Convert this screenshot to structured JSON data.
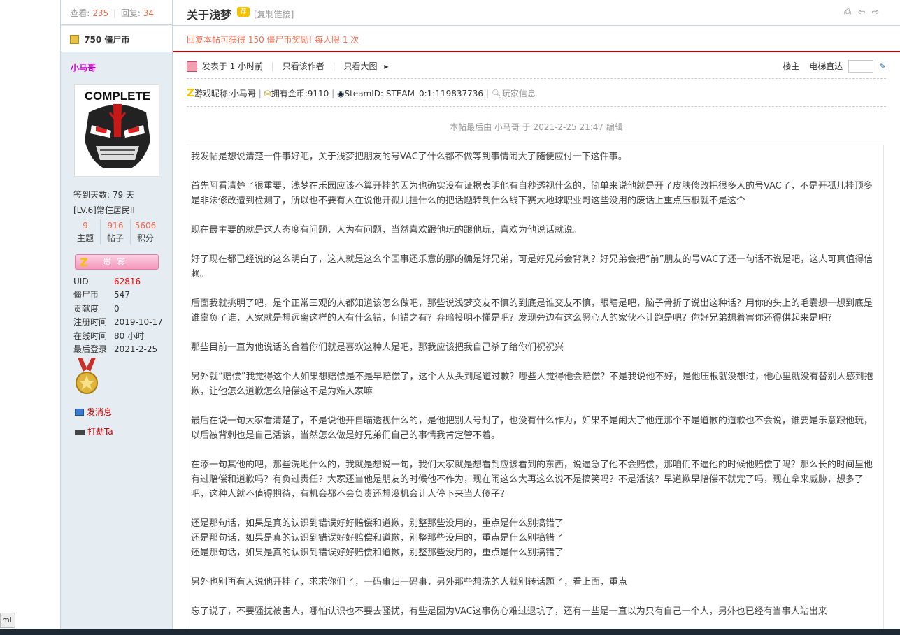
{
  "sidebar": {
    "views_label": "查看:",
    "views": "235",
    "replies_label": "回复:",
    "replies": "34",
    "coins_amount": "750",
    "coins_unit": "僵尸币",
    "username": "小马哥",
    "avatar_text": "COMPLETE",
    "checkin": "签到天数: 79 天",
    "level": "[LV.6]常住居民II",
    "stats": [
      {
        "value": "9",
        "label": "主题"
      },
      {
        "value": "916",
        "label": "帖子"
      },
      {
        "value": "5606",
        "label": "积分"
      }
    ],
    "vip_label": "贵宾",
    "vip_logo": "Z",
    "info": [
      {
        "key": "UID",
        "value": "62816"
      },
      {
        "key": "僵尸币",
        "value": "547"
      },
      {
        "key": "贡献度",
        "value": "0"
      },
      {
        "key": "注册时间",
        "value": "2019-10-17"
      },
      {
        "key": "在线时间",
        "value": "80 小时"
      },
      {
        "key": "最后登录",
        "value": "2021-2-25"
      }
    ],
    "send_message": "发消息",
    "rob": "打劫Ta"
  },
  "header": {
    "title": "关于浅梦",
    "badge": "荐",
    "copy_link": "[复制链接]",
    "reward_text": "回复本帖可获得 150 僵尸币奖励! 每人限 1 次"
  },
  "postbar": {
    "posted": "发表于 1 小时前",
    "only_author": "只看该作者",
    "large_image": "只看大图",
    "floor": "楼主",
    "elevator": "电梯直达"
  },
  "gameinfo": {
    "nickname": "游戏昵称:小马哥",
    "gold": "拥有金币:9110",
    "steam": "SteamID: STEAM_0:1:119837736",
    "player_info": "玩家信息"
  },
  "edited_note": "本帖最后由 小马哥 于 2021-2-25 21:47 编辑",
  "paragraphs": [
    "我发帖是想说清楚一件事好吧，关于浅梦把朋友的号VAC了什么都不做等到事情闹大了随便应付一下这件事。",
    "首先阿看清楚了很重要，浅梦在乐园应该不算开挂的因为也确实没有证据表明他有自秒透视什么的，简单来说他就是开了皮肤修改把很多人的号VAC了，不是开孤儿挂顶多是非法修改遭到检测了，所以也不要有人在说他开孤儿挂什么的把话题转到什么线下赛大地球职业哥这些没用的废话上重点压根就不是这个",
    "现在最主要的就是这人态度有问题，人为有问题，当然喜欢跟他玩的跟他玩，喜欢为他说话就说。",
    "好了现在都已经说的这么明白了，这人就是这么个回事还乐意的那的确是好兄弟，可是好兄弟会背刺？好兄弟会把“前”朋友的号VAC了还一句话不说是吧，这人可真值得信赖。",
    "后面我就挑明了吧，是个正常三观的人都知道该怎么做吧，那些说浅梦交友不慎的到底是谁交友不慎，眼瞎是吧，脑子骨折了说出这种话？用你的头上的毛囊想一想到底是谁辜负了谁，人家就是想远离这样的人有什么错，何错之有？弃暗投明不懂是吧？发现旁边有这么恶心人的家伙不让跑是吧？你好兄弟想着害你还得供起来是吧？",
    "那些目前一直为他说话的合着你们就是喜欢这种人是吧，那我应该把我自己杀了给你们祝祝兴",
    "另外就“赔偿”我觉得这个人如果想赔偿是不是早赔偿了，这个人从头到尾道过歉？哪些人觉得他会赔偿？不是我说他不好，是他压根就没想过，他心里就没有替别人感到抱歉，让他怎么道歉怎么赔偿这不是为难人家嘛",
    "最后在说一句大家看清楚了，不是说他开自瞄透视什么的，是他把别人号封了，也没有什么作为，如果不是闹大了他连那个不是道歉的道歉也不会说，谁要是乐意跟他玩，以后被背刺也是自己活该，当然怎么做是好兄弟们自己的事情我肯定管不着。",
    "在添一句其他的吧，那些洗地什么的，我就是想说一句，我们大家就是想看到应该看到的东西，说逼急了他不会赔偿，那咱们不逼他的时候他赔偿了吗？那么长的时间里他有过赔偿和道歉吗？有负过责任？大家还当他是朋友的时候他不作为，现在闹这么大再这么说不是搞笑吗？不是活该？早道歉早赔偿不就完了吗，现在拿来威胁，想多了吧，这种人就不值得期待，有机会都不会负责还想没机会让人停下来当人傻子？",
    "还是那句话，如果是真的认识到错误好好赔偿和道歉，别整那些没用的，重点是什么别搞错了",
    "还是那句话，如果是真的认识到错误好好赔偿和道歉，别整那些没用的，重点是什么别搞错了",
    "还是那句话，如果是真的认识到错误好好赔偿和道歉，别整那些没用的，重点是什么别搞错了",
    "另外也别再有人说他开挂了，求求你们了，一码事归一码事，另外那些想洗的人就别转话题了，看上面，重点",
    "忘了说了，不要骚扰被害人，哪怕认识也不要去骚扰，有些是因为VAC这事伤心难过退坑了，还有一些是一直以为只有自己一个人，另外也已经有当事人站出来"
  ],
  "tabtip": "ml",
  "colors": {
    "accent_red": "#f26c4f",
    "sidebar_bg": "#e5edf2",
    "border_blue": "#c2d5e3"
  }
}
